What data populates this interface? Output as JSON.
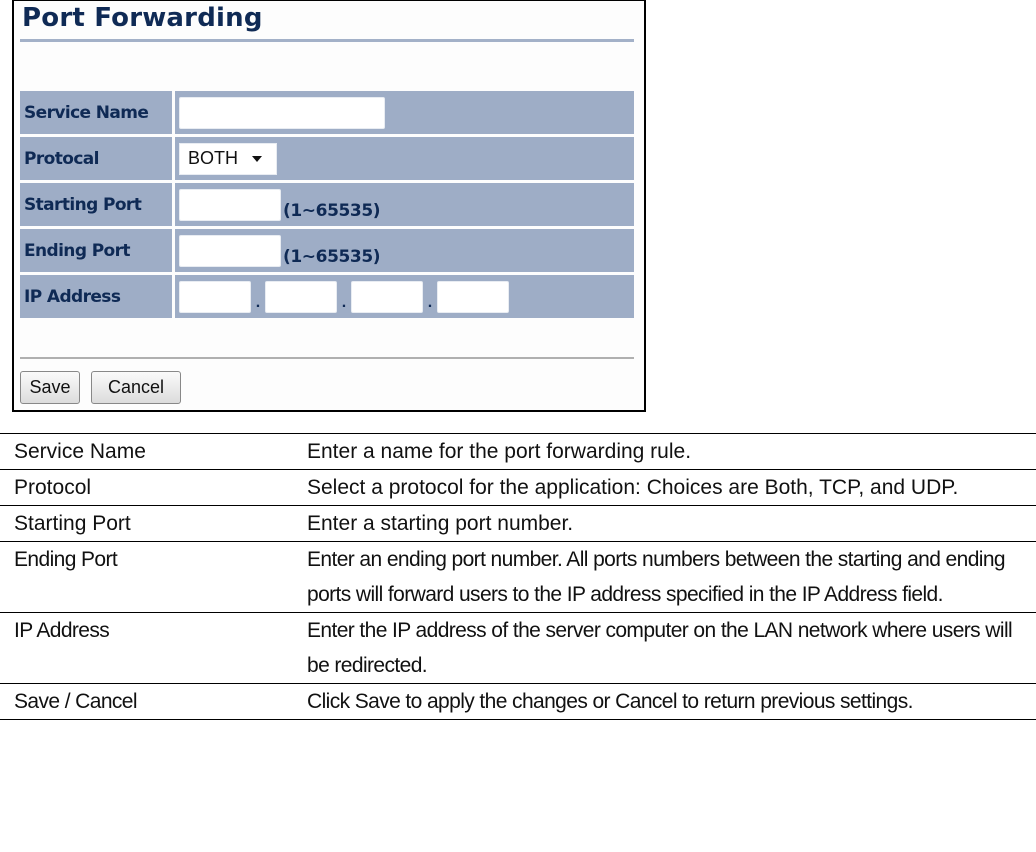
{
  "panel": {
    "title": "Port Forwarding",
    "fields": {
      "service_name": {
        "label": "Service Name",
        "value": ""
      },
      "protocol": {
        "label": "Protocal",
        "selected": "BOTH"
      },
      "starting_port": {
        "label": "Starting Port",
        "value": "",
        "range": "(1~65535)"
      },
      "ending_port": {
        "label": "Ending Port",
        "value": "",
        "range": "(1~65535)"
      },
      "ip_address": {
        "label": "IP Address",
        "octets": [
          "",
          "",
          "",
          ""
        ],
        "separator": "."
      }
    },
    "buttons": {
      "save": "Save",
      "cancel": "Cancel"
    },
    "colors": {
      "title": "#0f2a55",
      "row_bg": "#9eadc6",
      "rule": "#a3b1c8"
    }
  },
  "descriptions": [
    {
      "term": "Service Name",
      "text": "Enter a name for the port forwarding rule."
    },
    {
      "term": "Protocol",
      "text": "Select a protocol for the application: Choices are Both, TCP, and UDP."
    },
    {
      "term": "Starting Port",
      "text": "Enter a starting port number."
    },
    {
      "term": "Ending Port",
      "text": "Enter an ending port number. All ports numbers between the starting and ending ports will forward users to the IP address specified in the IP Address field."
    },
    {
      "term": "IP Address",
      "text": "Enter the IP address of the server computer on the LAN network where users will be redirected."
    },
    {
      "term": "Save / Cancel",
      "text": "Click Save to apply the changes or Cancel to return previous settings."
    }
  ]
}
